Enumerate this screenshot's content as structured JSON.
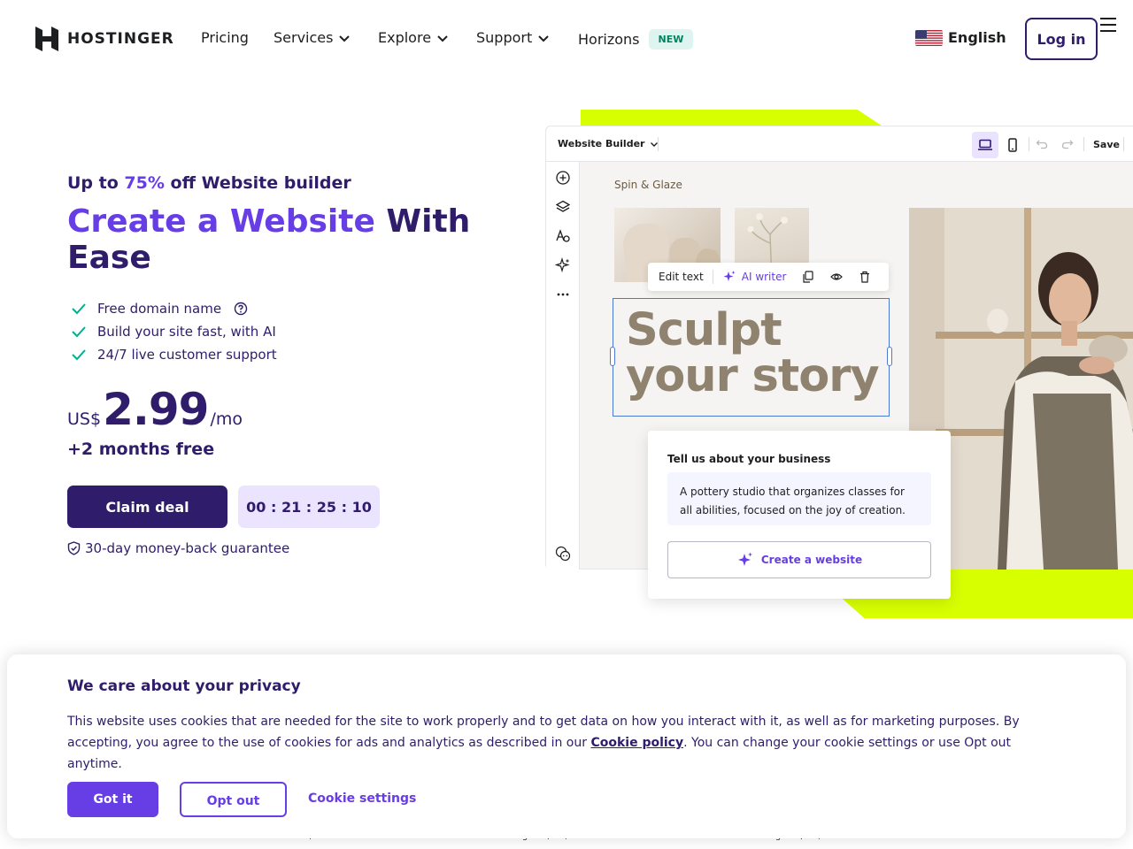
{
  "colors": {
    "primary_dark": "#2f1c6a",
    "primary": "#673de6",
    "accent_green": "#d7ff00",
    "new_badge_bg": "#def4f0",
    "new_badge_text": "#008361",
    "check_green": "#00b090"
  },
  "nav": {
    "logo_text": "HOSTINGER",
    "items": [
      {
        "label": "Pricing"
      },
      {
        "label": "Services"
      },
      {
        "label": "Explore"
      },
      {
        "label": "Support"
      },
      {
        "label": "Horizons",
        "badge": "NEW"
      }
    ],
    "language": "English",
    "login_label": "Log in"
  },
  "hero": {
    "promo_prefix": "Up to",
    "promo_percent": "75%",
    "promo_suffix": "off Website builder",
    "headline_accent": "Create a Website",
    "headline_rest": "With Ease",
    "features": [
      "Free domain name",
      "Build your site fast, with AI",
      "24/7 live customer support"
    ],
    "price_currency": "US$",
    "price_amount": "2.99",
    "price_period": "/mo",
    "bonus": "+2 months free",
    "cta_label": "Claim deal",
    "timer": "00 : 21 : 25 : 10",
    "guarantee": "30-day money-back guarantee"
  },
  "mockup": {
    "builder_label": "Website Builder",
    "save_label": "Save",
    "brand_name": "Spin & Glaze",
    "toolbar": {
      "edit_text": "Edit text",
      "ai_writer": "AI writer"
    },
    "headline_line1": "Sculpt",
    "headline_line2": "your story",
    "card_title": "Tell us about your business",
    "card_text": "A pottery studio that organizes classes for all abilities, focused on the joy of creation.",
    "card_button": "Create a website"
  },
  "cookie": {
    "title": "We care about your privacy",
    "text_before": "This website uses cookies that are needed for the site to work properly and to get data on how you interact with it, as well as for marketing purposes. By accepting, you agree to the use of cookies for ads and analytics as described in our ",
    "policy_link": "Cookie policy",
    "text_after": ". You can change your cookie settings or use Opt out anytime.",
    "got_it": "Got it",
    "opt_out": "Opt out",
    "settings": "Cookie settings"
  },
  "ratings": [
    "TrustScore 4.7 45,710 reviews",
    "Rating: 4.8/5 1,257 reviews",
    "Rating: 4.8/5 2,452 reviews"
  ]
}
